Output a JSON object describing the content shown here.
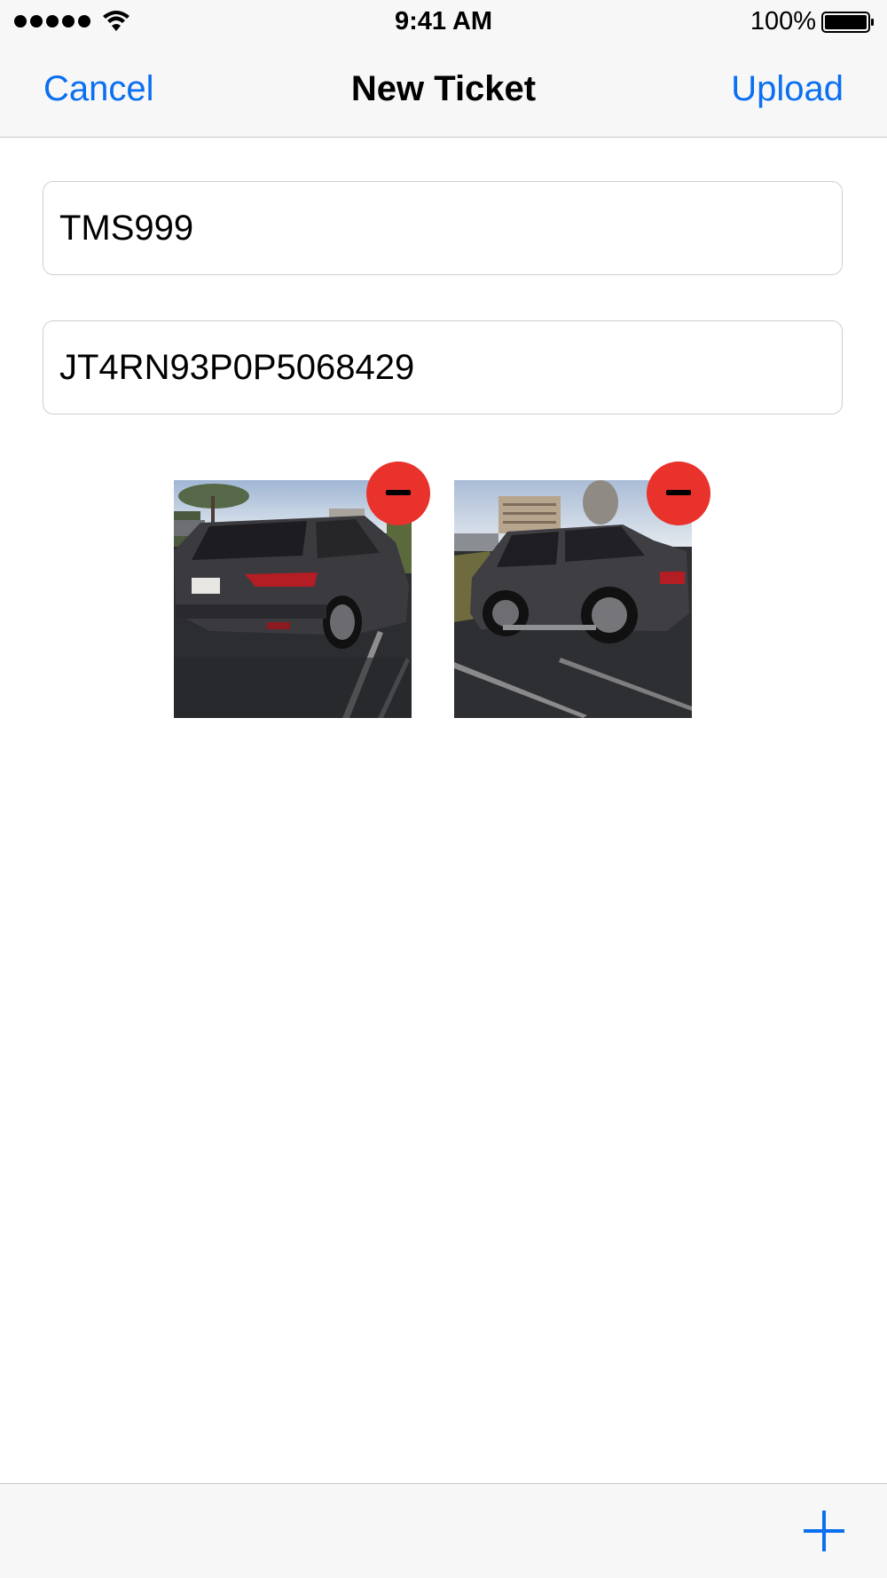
{
  "status_bar": {
    "time": "9:41 AM",
    "battery_percent": "100%",
    "signal_icon": "signal-dots-icon",
    "wifi_icon": "wifi-icon",
    "battery_icon": "battery-icon"
  },
  "nav": {
    "cancel_label": "Cancel",
    "title": "New Ticket",
    "upload_label": "Upload",
    "accent_color": "#0a6ff0"
  },
  "form": {
    "field_1_value": "TMS999",
    "field_2_value": "JT4RN93P0P5068429"
  },
  "photos": [
    {
      "description_icon": "car-photo-rear",
      "remove_icon": "minus-icon"
    },
    {
      "description_icon": "car-photo-side",
      "remove_icon": "minus-icon"
    }
  ],
  "toolbar": {
    "add_icon": "plus-icon"
  },
  "colors": {
    "remove_button": "#e8322b",
    "bar_background": "#f7f7f7"
  }
}
